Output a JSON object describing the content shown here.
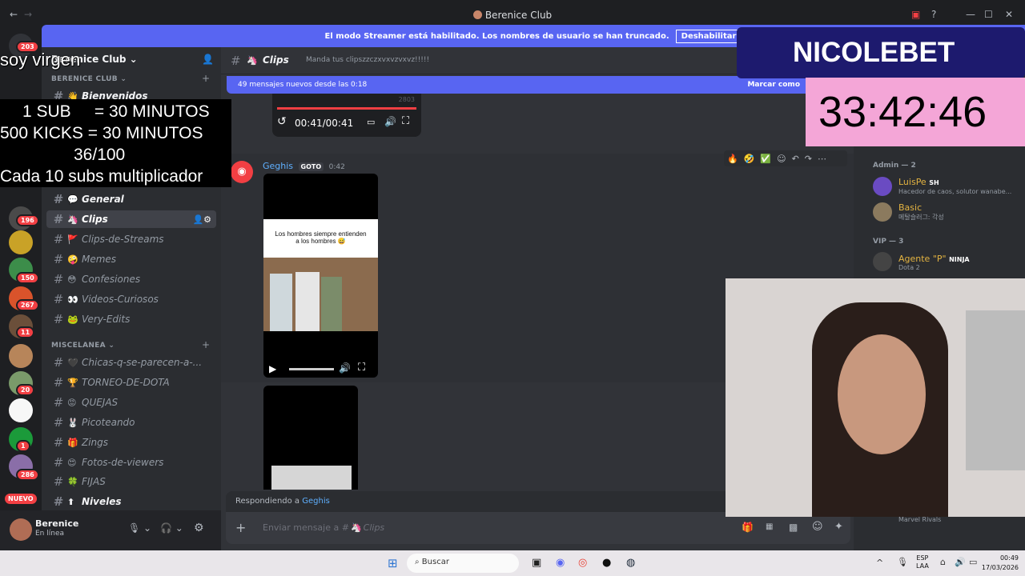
{
  "window": {
    "title": "Berenice Club"
  },
  "banner": {
    "text": "El modo Streamer está habilitado. Los nombres de usuario se han truncado.",
    "button": "Deshabilitar"
  },
  "rail_badges": [
    "203",
    "196",
    "150",
    "267",
    "11",
    "20",
    "1",
    "286"
  ],
  "rail_new": "NUEVO",
  "server": {
    "name": "Berenice Club"
  },
  "categories": {
    "club": "BERENICE CLUB",
    "misc": "MISCELANEA"
  },
  "channels": [
    {
      "emoji": "👋",
      "label": "Bienvenidos"
    },
    {
      "emoji": "💬",
      "label": "General"
    },
    {
      "emoji": "🦄",
      "label": "Clips"
    },
    {
      "emoji": "🚩",
      "label": "Clips-de-Streams"
    },
    {
      "emoji": "🤪",
      "label": "Memes"
    },
    {
      "emoji": "😳",
      "label": "Confesiones"
    },
    {
      "emoji": "👀",
      "label": "Videos-Curiosos"
    },
    {
      "emoji": "🐸",
      "label": "Very-Edits"
    },
    {
      "emoji": "🖤",
      "label": "Chicas-q-se-parecen-a-..."
    },
    {
      "emoji": "🏆",
      "label": "TORNEO-DE-DOTA"
    },
    {
      "emoji": "😡",
      "label": "QUEJAS"
    },
    {
      "emoji": "🐰",
      "label": "Picoteando"
    },
    {
      "emoji": "🎁",
      "label": "Zings"
    },
    {
      "emoji": "😍",
      "label": "Fotos-de-viewers"
    },
    {
      "emoji": "🍀",
      "label": "FIJAS"
    },
    {
      "emoji": "⬆",
      "label": "Niveles"
    }
  ],
  "channel_header": {
    "name": "Clips",
    "topic": "Manda tus clipszzczxvxvzvxvz!!!!!"
  },
  "new_messages": {
    "text": "49 mensajes nuevos desde las 0:18",
    "action": "Marcar como"
  },
  "audio": {
    "time": "00:41/00:41",
    "count": "2803"
  },
  "message": {
    "author": "Geghis",
    "tag": "GOTO",
    "time": "0:42",
    "video_caption": "Los hombres siempre entienden a los hombres 😅"
  },
  "reply": {
    "prefix": "Respondiendo a",
    "user": "Geghis"
  },
  "composer": {
    "placeholder": "Enviar mensaje a #",
    "channel": "Clips"
  },
  "user": {
    "name": "Berenice",
    "status": "En línea"
  },
  "members": {
    "admin_header": "Admin — 2",
    "vip_header": "VIP — 3",
    "list": [
      {
        "name": "LuisPe",
        "tag": "SH",
        "status": "Hacedor de caos, solutor wanabe..."
      },
      {
        "name": "Basic",
        "status": "메탈슬러그: 각성"
      },
      {
        "name": "Agente \"P\"",
        "tag": "NINJA",
        "status": "Dota 2"
      },
      {
        "name": "",
        "status": "Marvel Rivals"
      }
    ]
  },
  "overlay": {
    "lines": [
      "soy virgen",
      "1 SUB     = 30 MINUTOS",
      "500 KICKS = 30 MINUTOS",
      "36/100",
      "Cada 10 subs multiplicador"
    ],
    "brand": "NICOLEBET",
    "timer": "33:42:46"
  },
  "taskbar": {
    "search": "Buscar",
    "lang1": "ESP",
    "lang2": "LAA",
    "time": "00:49",
    "date": "17/03/2026"
  }
}
